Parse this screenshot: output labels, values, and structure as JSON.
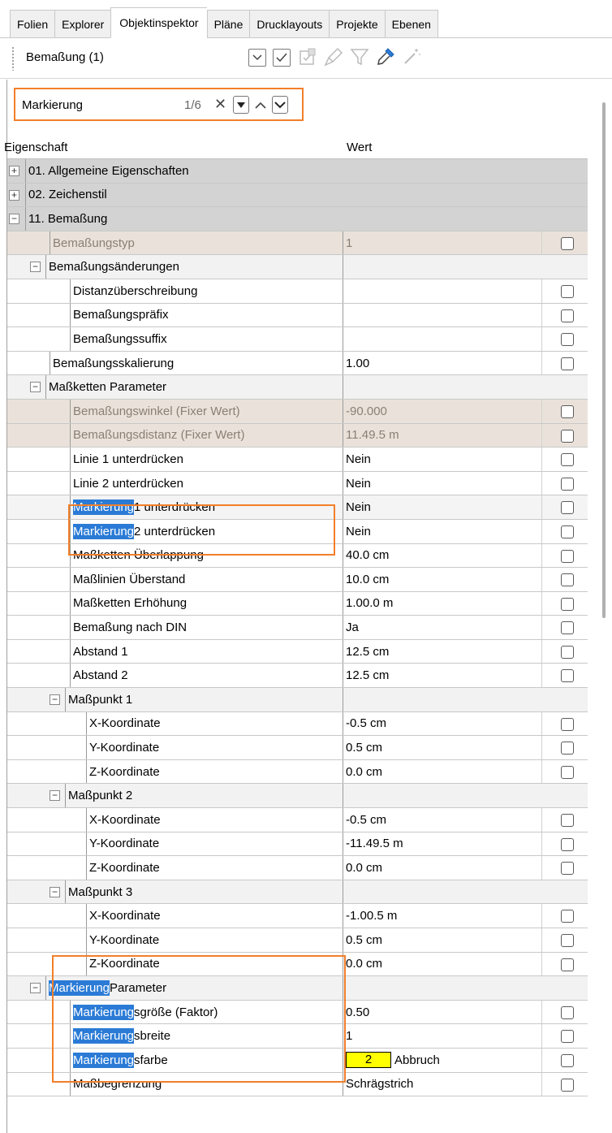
{
  "tabs": [
    {
      "label": "Folien",
      "active": false
    },
    {
      "label": "Explorer",
      "active": false
    },
    {
      "label": "Objektinspektor",
      "active": true
    },
    {
      "label": "Pläne",
      "active": false
    },
    {
      "label": "Drucklayouts",
      "active": false
    },
    {
      "label": "Projekte",
      "active": false
    },
    {
      "label": "Ebenen",
      "active": false
    }
  ],
  "toolbar": {
    "title": "Bemaßung (1)",
    "icons": [
      "chevron-down-icon",
      "checkmark-icon",
      "checkbox-grid-icon",
      "brush-icon",
      "filter-icon",
      "eyedropper-icon",
      "wand-icon"
    ]
  },
  "search": {
    "value": "Markierung",
    "count": "1/6",
    "clear": "✕"
  },
  "grid": {
    "header_property": "Eigenschaft",
    "header_value": "Wert",
    "rows": [
      {
        "type": "cat",
        "indent": 0,
        "expander": "+",
        "name": "01. Allgemeine Eigenschaften",
        "value": ""
      },
      {
        "type": "cat",
        "indent": 0,
        "expander": "+",
        "name": "02. Zeichenstil",
        "value": ""
      },
      {
        "type": "cat",
        "indent": 0,
        "expander": "−",
        "name": "11. Bemaßung",
        "value": ""
      },
      {
        "type": "dis",
        "indent": 1,
        "name": "Bemaßungstyp",
        "value": "1"
      },
      {
        "type": "grp",
        "indent": 1,
        "expander": "−",
        "name": "Bemaßungsänderungen",
        "value": ""
      },
      {
        "type": "prop",
        "indent": 2,
        "name": "Distanzüberschreibung",
        "value": ""
      },
      {
        "type": "prop",
        "indent": 2,
        "name": "Bemaßungspräfix",
        "value": ""
      },
      {
        "type": "prop",
        "indent": 2,
        "name": "Bemaßungssuffix",
        "value": ""
      },
      {
        "type": "prop",
        "indent": 1,
        "name": "Bemaßungsskalierung",
        "value": "1.00"
      },
      {
        "type": "grp",
        "indent": 1,
        "expander": "−",
        "name": "Maßketten Parameter",
        "value": ""
      },
      {
        "type": "dis",
        "indent": 2,
        "name": "Bemaßungswinkel (Fixer Wert)",
        "value": "-90.000"
      },
      {
        "type": "dis",
        "indent": 2,
        "name": "Bemaßungsdistanz (Fixer Wert)",
        "value": "11.49.5 m"
      },
      {
        "type": "prop",
        "indent": 2,
        "name": "Linie 1 unterdrücken",
        "value": "Nein"
      },
      {
        "type": "prop",
        "indent": 2,
        "name": "Linie 2 unterdrücken",
        "value": "Nein"
      },
      {
        "type": "prop",
        "indent": 2,
        "hl": "Markierung",
        "name": " 1 unterdrücken",
        "value": "Nein",
        "sel": true
      },
      {
        "type": "prop",
        "indent": 2,
        "hl": "Markierung",
        "name": " 2 unterdrücken",
        "value": "Nein"
      },
      {
        "type": "prop",
        "indent": 2,
        "name": "Maßketten Überlappung",
        "value": "40.0 cm"
      },
      {
        "type": "prop",
        "indent": 2,
        "name": "Maßlinien Überstand",
        "value": "10.0 cm"
      },
      {
        "type": "prop",
        "indent": 2,
        "name": "Maßketten Erhöhung",
        "value": "1.00.0 m"
      },
      {
        "type": "prop",
        "indent": 2,
        "name": "Bemaßung nach DIN",
        "value": "Ja"
      },
      {
        "type": "prop",
        "indent": 2,
        "name": "Abstand 1",
        "value": "12.5 cm"
      },
      {
        "type": "prop",
        "indent": 2,
        "name": "Abstand 2",
        "value": "12.5 cm"
      },
      {
        "type": "grp",
        "indent": 2,
        "expander": "−",
        "name": "Maßpunkt 1",
        "value": ""
      },
      {
        "type": "prop",
        "indent": 3,
        "name": "X-Koordinate",
        "value": "-0.5 cm"
      },
      {
        "type": "prop",
        "indent": 3,
        "name": "Y-Koordinate",
        "value": "0.5 cm"
      },
      {
        "type": "prop",
        "indent": 3,
        "name": "Z-Koordinate",
        "value": "0.0 cm"
      },
      {
        "type": "grp",
        "indent": 2,
        "expander": "−",
        "name": "Maßpunkt 2",
        "value": ""
      },
      {
        "type": "prop",
        "indent": 3,
        "name": "X-Koordinate",
        "value": "-0.5 cm"
      },
      {
        "type": "prop",
        "indent": 3,
        "name": "Y-Koordinate",
        "value": "-11.49.5 m"
      },
      {
        "type": "prop",
        "indent": 3,
        "name": "Z-Koordinate",
        "value": "0.0 cm"
      },
      {
        "type": "grp",
        "indent": 2,
        "expander": "−",
        "name": "Maßpunkt 3",
        "value": ""
      },
      {
        "type": "prop",
        "indent": 3,
        "name": "X-Koordinate",
        "value": "-1.00.5 m"
      },
      {
        "type": "prop",
        "indent": 3,
        "name": "Y-Koordinate",
        "value": "0.5 cm"
      },
      {
        "type": "prop",
        "indent": 3,
        "name": "Z-Koordinate",
        "value": "0.0 cm"
      },
      {
        "type": "grp",
        "indent": 1,
        "expander": "−",
        "hl": "Markierung",
        "name": " Parameter",
        "value": ""
      },
      {
        "type": "prop",
        "indent": 2,
        "hl": "Markierung",
        "name": "sgröße (Faktor)",
        "value": "0.50"
      },
      {
        "type": "prop",
        "indent": 2,
        "hl": "Markierung",
        "name": "sbreite",
        "value": "1"
      },
      {
        "type": "prop",
        "indent": 2,
        "hl": "Markierung",
        "name": "sfarbe",
        "value": "Abbruch",
        "color_chip": "2",
        "color_hex": "#ffff00"
      },
      {
        "type": "prop",
        "indent": 2,
        "name": "Maßbegrenzung",
        "value": "Schrägstrich"
      }
    ]
  },
  "colors": {
    "highlight": "#2b7bd6",
    "orange_outline": "#f27f2a",
    "category_bg": "#d3d3d3",
    "disabled_bg": "#eae2da"
  }
}
